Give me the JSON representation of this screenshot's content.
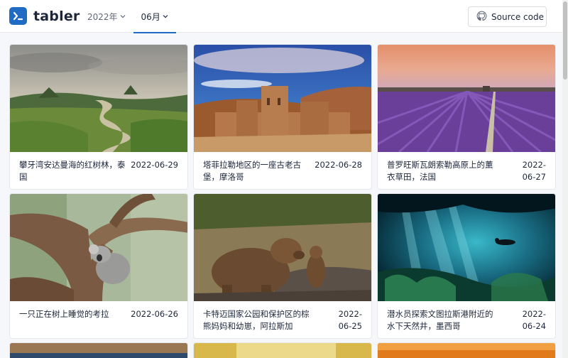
{
  "app": {
    "brand": "tabler"
  },
  "nav": {
    "year": "2022年",
    "month": "06月"
  },
  "header": {
    "source_label": "Source code"
  },
  "cards": [
    {
      "title": "攀牙湾安达曼海的红树林，泰国",
      "date": "2022-06-29"
    },
    {
      "title": "塔菲拉勒地区的一座古老古堡，摩洛哥",
      "date": "2022-06-28"
    },
    {
      "title": "普罗旺斯瓦朗索勒高原上的薰衣草田，法国",
      "date": "2022-06-27"
    },
    {
      "title": "一只正在树上睡觉的考拉",
      "date": "2022-06-26"
    },
    {
      "title": "卡特迈国家公园和保护区的棕熊妈妈和幼崽，阿拉斯加",
      "date": "2022-06-25"
    },
    {
      "title": "潜水员探索文图拉斯港附近的水下天然井，墨西哥",
      "date": "2022-06-24"
    }
  ],
  "colors": {
    "primary": "#206bc4",
    "background": "#f5f7fb",
    "text": "#1d273b"
  }
}
